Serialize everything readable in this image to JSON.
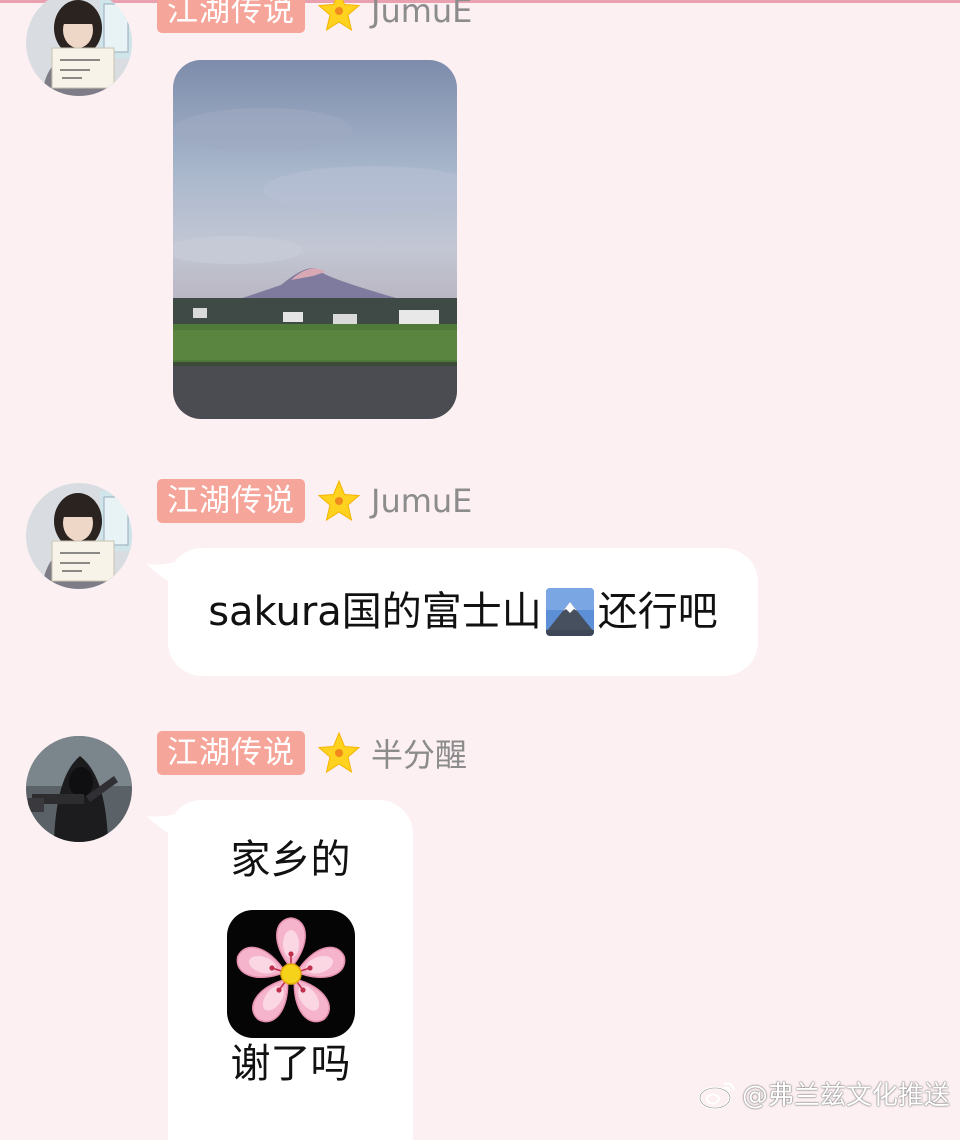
{
  "messages": [
    {
      "badge": "江湖传说",
      "nick": "JumuE",
      "avatar": "avatar-girl-with-sign",
      "type": "image",
      "image": "mount-fuji-photo"
    },
    {
      "badge": "江湖传说",
      "nick": "JumuE",
      "avatar": "avatar-girl-with-sign",
      "type": "text",
      "text_before": "sakura国的富士山",
      "emoji": "mount-fuji-emoji",
      "text_after": "还行吧"
    },
    {
      "badge": "江湖传说",
      "nick": "半分醒",
      "avatar": "avatar-hooded-figure",
      "type": "text",
      "line1": "家乡的",
      "emoji": "cherry-blossom-emoji",
      "line2": "谢了吗"
    }
  ],
  "watermark": {
    "text": "@弗兰兹文化推送",
    "icon": "weibo-icon"
  },
  "colors": {
    "background": "#fcf0f2",
    "badge": "#f6a59a",
    "nick": "#8c8c8c",
    "bubble": "#ffffff"
  }
}
